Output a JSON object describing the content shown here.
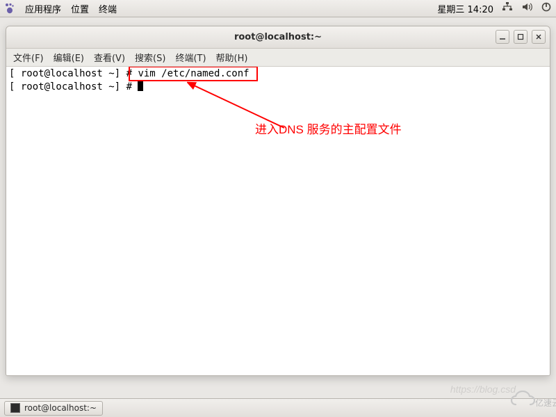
{
  "panel": {
    "apps": "应用程序",
    "places": "位置",
    "terminal_menu": "终端",
    "clock": "星期三 14:20"
  },
  "window": {
    "title": "root@localhost:~",
    "menus": {
      "file": "文件(F)",
      "edit": "编辑(E)",
      "view": "查看(V)",
      "search": "搜索(S)",
      "terminal": "终端(T)",
      "help": "帮助(H)"
    }
  },
  "terminal": {
    "prompt1_prefix": "[ root@localhost ~] # ",
    "command": "vim /etc/named.conf",
    "prompt2": "[ root@localhost ~] # "
  },
  "annotation": {
    "text": "进入DNS 服务的主配置文件"
  },
  "taskbar": {
    "item": "root@localhost:~"
  },
  "watermark": {
    "text": "https://blog.csd",
    "logo": "亿速云"
  }
}
